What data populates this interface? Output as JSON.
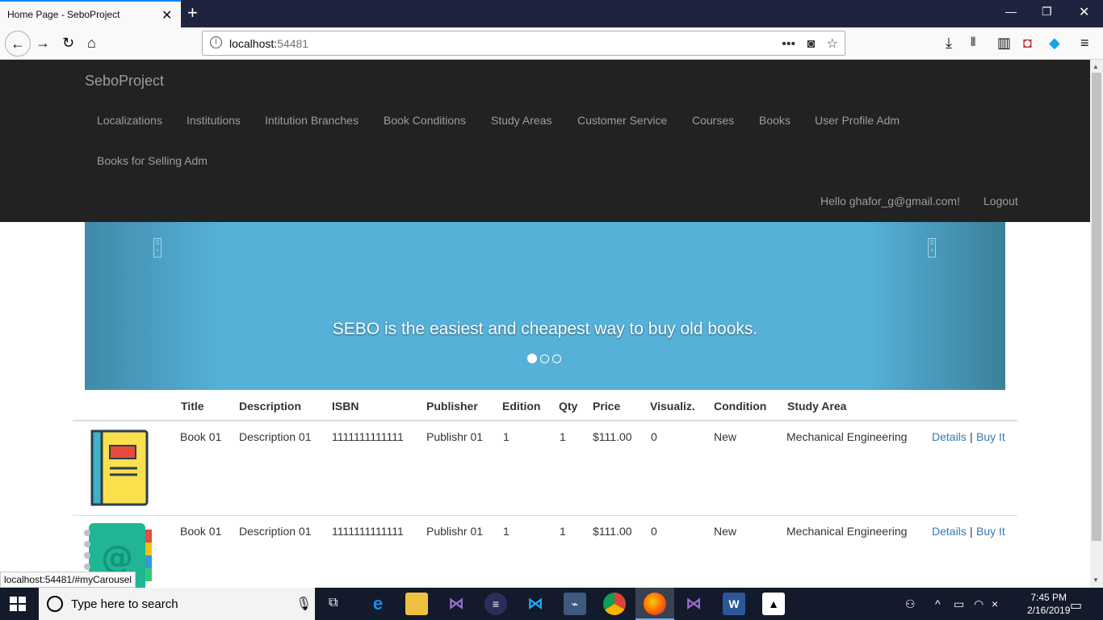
{
  "browser": {
    "tab_title": "Home Page - SeboProject",
    "url_host": "localhost:",
    "url_port": "54481",
    "status_url": "localhost:54481/#myCarousel"
  },
  "site": {
    "brand": "SeboProject",
    "nav_items": [
      "Localizations",
      "Institutions",
      "Intitution Branches",
      "Book Conditions",
      "Study Areas",
      "Customer Service",
      "Courses",
      "Books",
      "User Profile Adm",
      "Books for Selling Adm"
    ],
    "greeting": "Hello ghafor_g@gmail.com!",
    "logout": "Logout"
  },
  "carousel": {
    "caption": "SEBO is the easiest and cheapest way to buy old books.",
    "slides": 3,
    "active_slide": 1
  },
  "table": {
    "headers": [
      "Title",
      "Description",
      "ISBN",
      "Publisher",
      "Edition",
      "Qty",
      "Price",
      "Visualiz.",
      "Condition",
      "Study Area"
    ],
    "rows": [
      {
        "title": "Book 01",
        "description": "Description 01",
        "isbn": "1111111111111",
        "publisher": "Publishr 01",
        "edition": "1",
        "qty": "1",
        "price": "$111.00",
        "visualiz": "0",
        "condition": "New",
        "study_area": "Mechanical Engineering",
        "details": "Details",
        "sep": "|",
        "buy": "Buy It"
      },
      {
        "title": "Book 01",
        "description": "Description 01",
        "isbn": "1111111111111",
        "publisher": "Publishr 01",
        "edition": "1",
        "qty": "1",
        "price": "$111.00",
        "visualiz": "0",
        "condition": "New",
        "study_area": "Mechanical Engineering",
        "details": "Details",
        "sep": "|",
        "buy": "Buy It"
      }
    ]
  },
  "taskbar": {
    "search_placeholder": "Type here to search",
    "time": "7:45 PM",
    "date": "2/16/2019"
  }
}
